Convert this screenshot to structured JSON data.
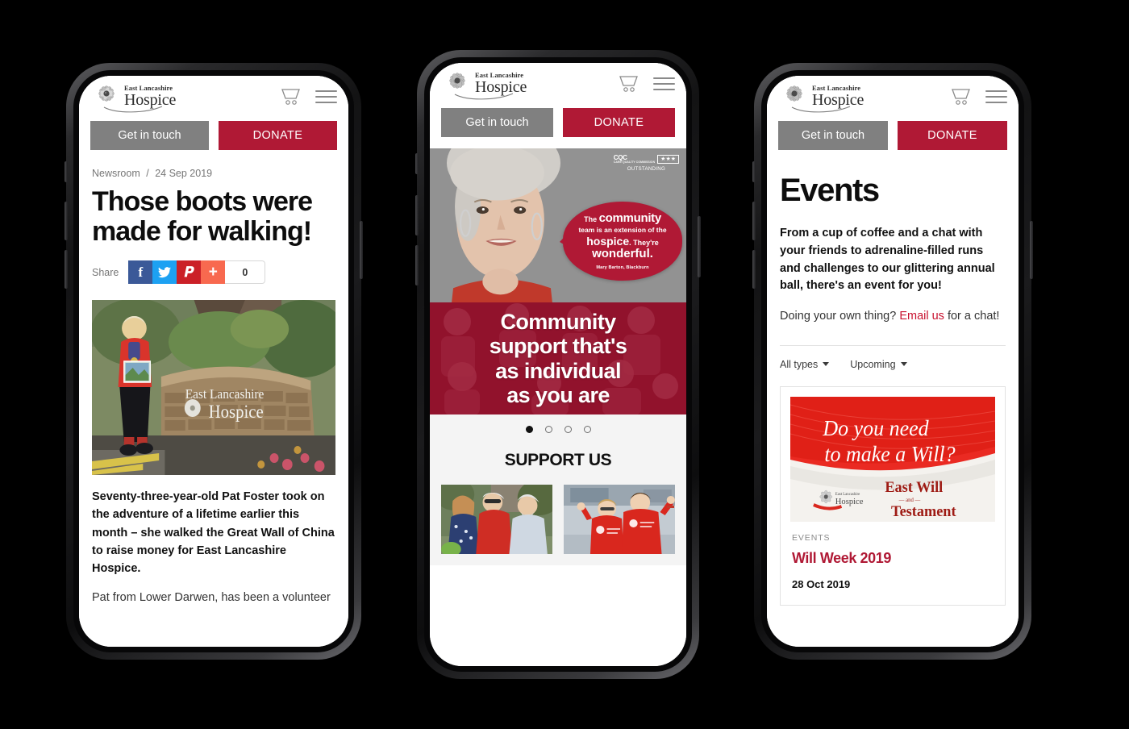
{
  "brand": {
    "accent_red": "#b01935",
    "link_red": "#c8102e",
    "grey_button": "#808080",
    "logo_line1": "East Lancashire",
    "logo_line2": "Hospice"
  },
  "header": {
    "get_in_touch_label": "Get in touch",
    "donate_label": "DONATE",
    "cart_icon": "cart-icon",
    "menu_icon": "hamburger-menu-icon"
  },
  "phone1": {
    "breadcrumb_section": "Newsroom",
    "breadcrumb_separator": "/",
    "breadcrumb_date": "24 Sep 2019",
    "headline": "Those boots were made for walking!",
    "share": {
      "label": "Share",
      "facebook_glyph": "f",
      "twitter_glyph": "ᴛ",
      "pinterest_glyph": "𝑷",
      "addthis_glyph": "+",
      "count": "0"
    },
    "photo_alt": "Pat Foster in a red hospice t-shirt standing beside the East Lancashire Hospice stone sign",
    "photo_sign_line1": "East Lancashire",
    "photo_sign_line2": "Hospice",
    "lead_paragraph": "Seventy-three-year-old Pat Foster took on the adventure of a lifetime earlier this month – she walked the Great Wall of China to raise money for East Lancashire Hospice.",
    "next_paragraph": "Pat from Lower Darwen, has been a volunteer"
  },
  "phone2": {
    "cqc_badge": {
      "logo": "CQC",
      "logo_sub": "CARE QUALITY COMMISSION",
      "stars": "★★★",
      "rating": "OUTSTANDING"
    },
    "quote_bubble": {
      "line1_small": "The",
      "line1_big": "community",
      "line2": "team is an extension of the",
      "line3_big": "hospice",
      "line3_small": ". They're",
      "line4": "wonderful.",
      "attribution": "Mary Barton, Blackburn"
    },
    "banner_lines": [
      "Community",
      "support that's",
      "as individual",
      "as you are"
    ],
    "carousel": {
      "total_dots": 4,
      "active_index": 0
    },
    "support_heading": "SUPPORT US",
    "support_cards": [
      {
        "alt": "Three people smiling outdoors, one in a red hospice fleece"
      },
      {
        "alt": "Two children wearing red East Lancashire Hospice t-shirts"
      }
    ]
  },
  "phone3": {
    "page_title": "Events",
    "intro": "From a cup of coffee and a chat with your friends to adrenaline-filled runs and challenges to our glittering annual ball, there's an event for you!",
    "cta_prefix": "Doing your own thing? ",
    "cta_link": "Email us",
    "cta_suffix": " for a chat!",
    "filters": [
      {
        "label": "All types"
      },
      {
        "label": "Upcoming"
      }
    ],
    "event_card": {
      "image_line1": "Do you need",
      "image_line2": "to make a Will?",
      "image_doc_line1": "East Will",
      "image_doc_line2": "— and —",
      "image_doc_line3": "Testament",
      "image_logo_top": "East Lancashire",
      "image_logo_main": "Hospice",
      "category": "EVENTS",
      "title": "Will Week 2019",
      "date": "28 Oct 2019"
    }
  }
}
